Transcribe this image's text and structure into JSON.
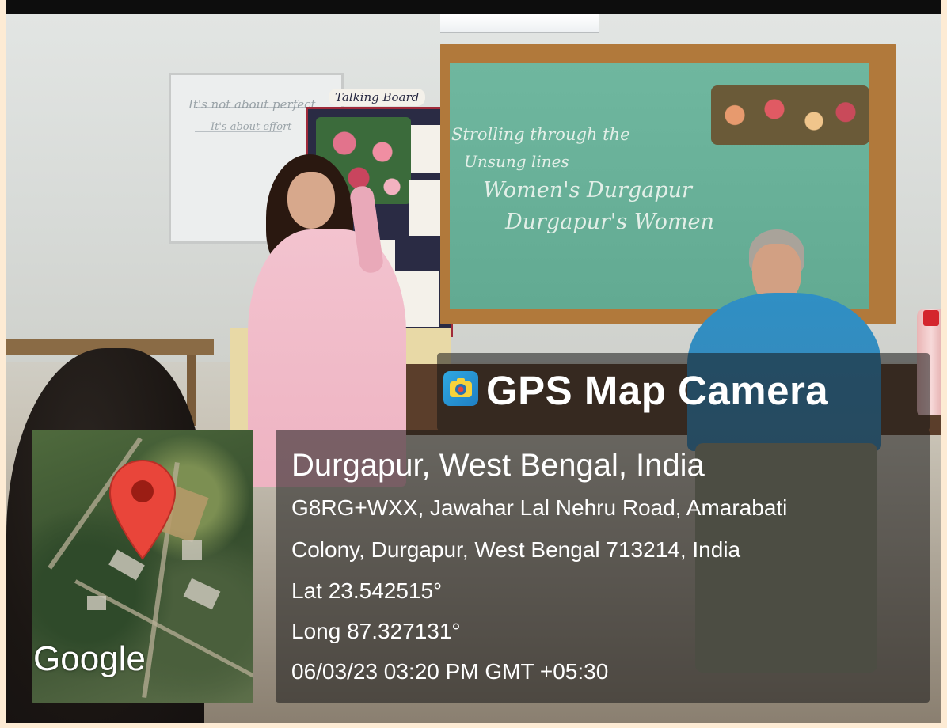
{
  "overlay": {
    "app_name": "GPS Map Camera",
    "map_brand": "Google",
    "location_title": "Durgapur, West Bengal, India",
    "address_line1": "G8RG+WXX, Jawahar Lal Nehru Road, Amarabati",
    "address_line2": "Colony, Durgapur, West Bengal 713214, India",
    "latitude": "Lat 23.542515°",
    "longitude": "Long 87.327131°",
    "timestamp": "06/03/23 03:20 PM GMT +05:30",
    "app_icon": "gps-camera-app-icon",
    "pin_icon": "map-pin-icon",
    "pin_color": "#e9453a"
  },
  "scene": {
    "chalkboard_lines": [
      "Strolling through the",
      "Unsung lines",
      "Women's Durgapur",
      "Durgapur's Women"
    ],
    "whiteboard_lines": [
      "It's not about perfect",
      "It's about effort"
    ],
    "notice_board_header": "Talking Board"
  }
}
